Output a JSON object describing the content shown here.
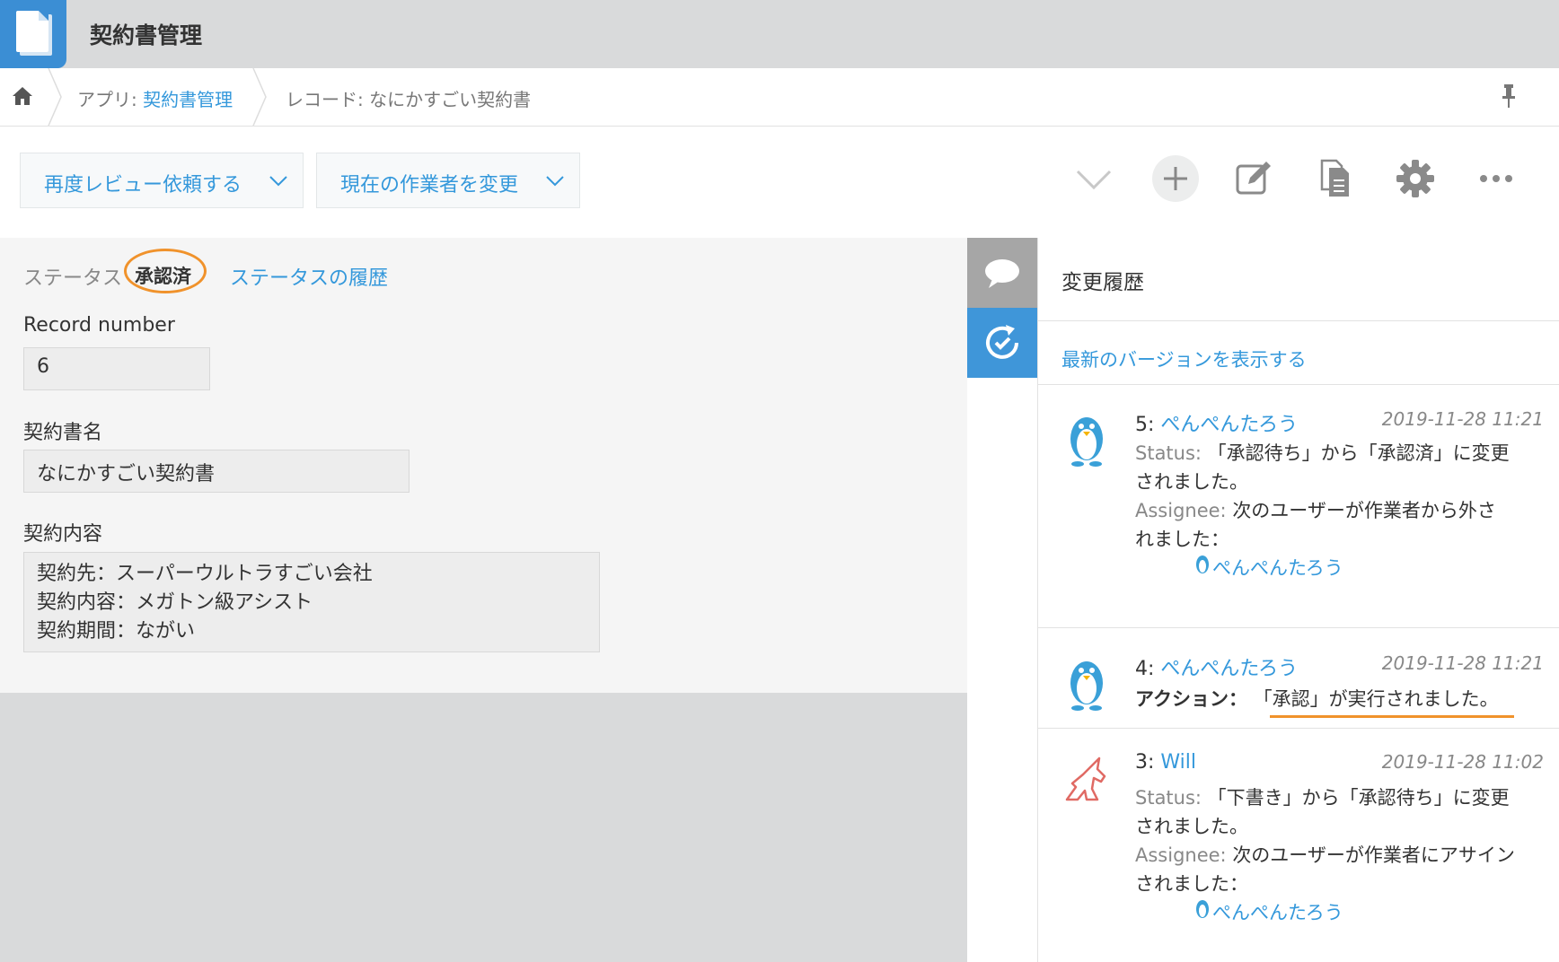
{
  "app": {
    "title": "契約書管理"
  },
  "breadcrumb": {
    "app_prefix": "アプリ: ",
    "app_name": "契約書管理",
    "record_label": "レコード: なにかすごい契約書"
  },
  "toolbar": {
    "action1": "再度レビュー依頼する",
    "action2": "現在の作業者を変更"
  },
  "record": {
    "status_label": "ステータス",
    "status_value": "承認済",
    "status_history_link": "ステータスの履歴",
    "fields": {
      "record_number_label": "Record number",
      "record_number_value": "6",
      "name_label": "契約書名",
      "name_value": "なにかすごい契約書",
      "content_label": "契約内容",
      "content_lines": [
        "契約先：スーパーウルトラすごい会社",
        "契約内容：メガトン級アシスト",
        "契約期間：ながい"
      ]
    }
  },
  "history_panel": {
    "title": "変更履歴",
    "latest_link": "最新のバージョンを表示する",
    "entries": [
      {
        "num": "5: ",
        "user": "ぺんぺんたろう",
        "date": "2019-11-28 11:21",
        "status_key": "Status: ",
        "status_text_1": "「承認待ち」から「承認済」に変更",
        "status_text_2": "されました。",
        "assignee_key": "Assignee: ",
        "assignee_text_1": "次のユーザーが作業者から外さ",
        "assignee_text_2": "れました：",
        "assignee_user": "ぺんぺんたろう",
        "avatar": "penguin-avatar"
      },
      {
        "num": "4: ",
        "user": "ぺんぺんたろう",
        "date": "2019-11-28 11:21",
        "action_key": "アクション：",
        "action_text": "「承認」が実行されました。",
        "avatar": "penguin-avatar"
      },
      {
        "num": "3: ",
        "user": "Will",
        "date": "2019-11-28 11:02",
        "status_key": "Status: ",
        "status_text_1": "「下書き」から「承認待ち」に変更",
        "status_text_2": "されました。",
        "assignee_key": "Assignee: ",
        "assignee_text_1": "次のユーザーが作業者にアサイン",
        "assignee_text_2": "されました：",
        "assignee_user": "ぺんぺんたろう",
        "avatar": "unicorn-avatar"
      }
    ]
  },
  "colors": {
    "accent": "#3498db",
    "highlight": "#f0922b",
    "history_tab": "#3f96d9"
  }
}
